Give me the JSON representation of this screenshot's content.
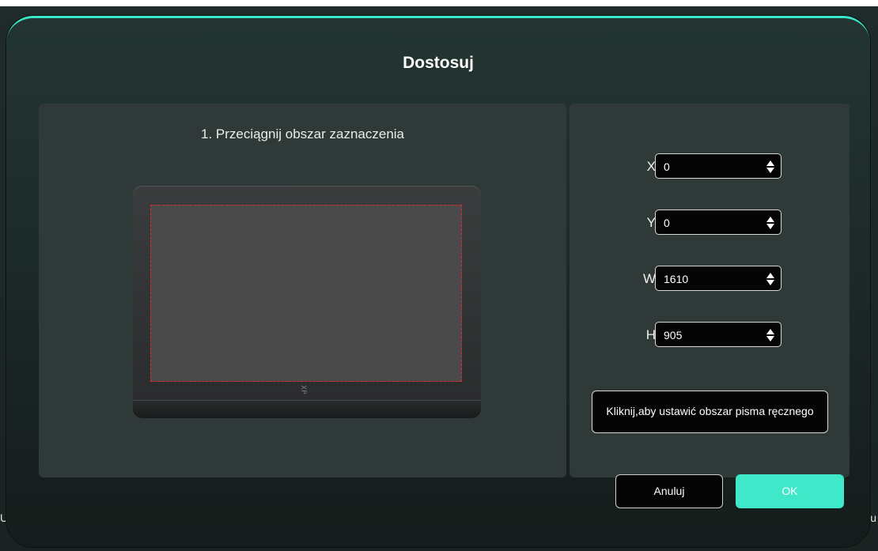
{
  "background": {
    "left_text": "Us",
    "right_text": "u"
  },
  "dialog": {
    "title": "Dostosuj",
    "accent_color": "#3fe8c9",
    "instruction": "1. Przeciągnij obszar zaznaczenia",
    "fields": {
      "x": {
        "label": "X",
        "value": "0"
      },
      "y": {
        "label": "Y",
        "value": "0"
      },
      "w": {
        "label": "W",
        "value": "1610"
      },
      "h": {
        "label": "H",
        "value": "905"
      }
    },
    "handwriting_button_label": "Kliknij,aby ustawić obszar pisma ręcznego",
    "cancel_label": "Anuluj",
    "ok_label": "OK",
    "tablet_logo": "XP"
  }
}
